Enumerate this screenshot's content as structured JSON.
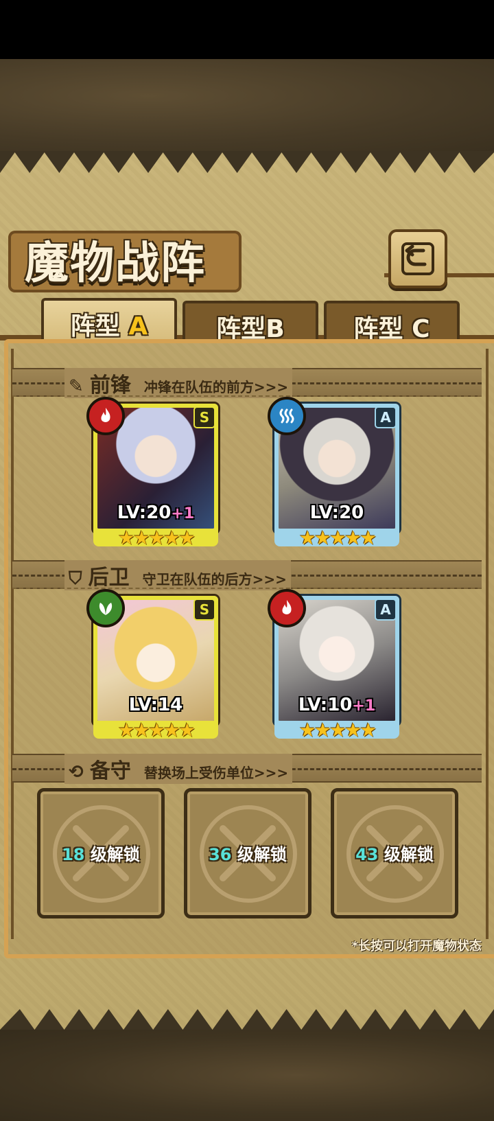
{
  "title": "魔物战阵",
  "tabs": [
    {
      "label": "阵型",
      "suffix": "A",
      "active": true
    },
    {
      "label": "阵型",
      "suffix": "B",
      "active": false
    },
    {
      "label": "阵型",
      "suffix": "C",
      "active": false
    }
  ],
  "sections": {
    "front": {
      "name": "前锋",
      "desc": "冲锋在队伍的前方>>>"
    },
    "back": {
      "name": "后卫",
      "desc": "守卫在队伍的后方>>>"
    },
    "reserve": {
      "name": "备守",
      "desc": "替换场上受伤单位>>>"
    }
  },
  "units": [
    {
      "element": "fire",
      "rank": "S",
      "level": "LV:20",
      "bonus": "+1",
      "stars": "★★★★★",
      "theme": "silver hair red hood"
    },
    {
      "element": "water",
      "rank": "A",
      "level": "LV:20",
      "bonus": "",
      "stars": "★★★★★",
      "theme": "hooded feathered"
    },
    {
      "element": "grass",
      "rank": "S",
      "level": "LV:14",
      "bonus": "",
      "stars": "★★★★★",
      "theme": "blonde pink bow"
    },
    {
      "element": "fire",
      "rank": "A",
      "level": "LV:10",
      "bonus": "+1",
      "stars": "★★★★★",
      "theme": "white hair dark"
    }
  ],
  "locked_slots": [
    {
      "level": "18",
      "text": "级解锁"
    },
    {
      "level": "36",
      "text": "级解锁"
    },
    {
      "level": "43",
      "text": "级解锁"
    }
  ],
  "hint": "*长按可以打开魔物状态",
  "colors": {
    "fire": "#c62121",
    "water": "#2b85c4",
    "grass": "#3d8b2c",
    "rank_s": "#e8e23a",
    "rank_a": "#9fd4ea"
  }
}
